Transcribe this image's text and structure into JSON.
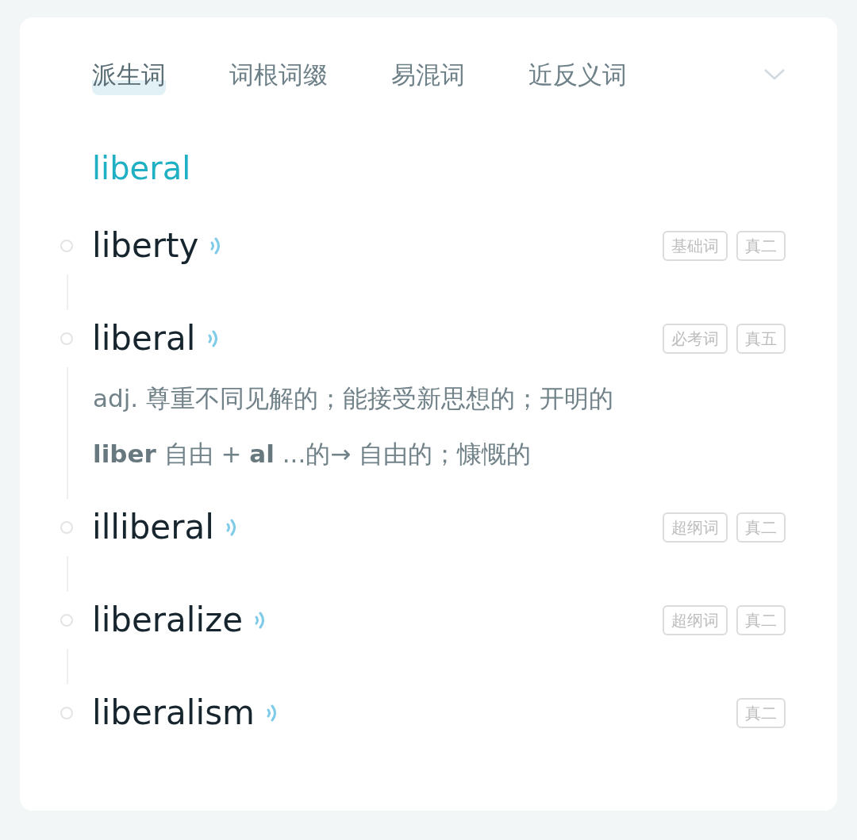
{
  "tabs": [
    {
      "label": "派生词",
      "selected": true
    },
    {
      "label": "词根词缀",
      "selected": false
    },
    {
      "label": "易混词",
      "selected": false
    },
    {
      "label": "近反义词",
      "selected": false
    }
  ],
  "headword": "liberal",
  "entries": [
    {
      "word": "liberty",
      "tags": [
        "基础词",
        "真二"
      ]
    },
    {
      "word": "liberal",
      "tags": [
        "必考词",
        "真五"
      ],
      "lines": [
        "adj. 尊重不同见解的；能接受新思想的；开明的",
        "**liber** 自由 + **al** ...的→ 自由的；慷慨的"
      ]
    },
    {
      "word": "illiberal",
      "tags": [
        "超纲词",
        "真二"
      ]
    },
    {
      "word": "liberalize",
      "tags": [
        "超纲词",
        "真二"
      ]
    },
    {
      "word": "liberalism",
      "tags": [
        "真二"
      ]
    }
  ]
}
